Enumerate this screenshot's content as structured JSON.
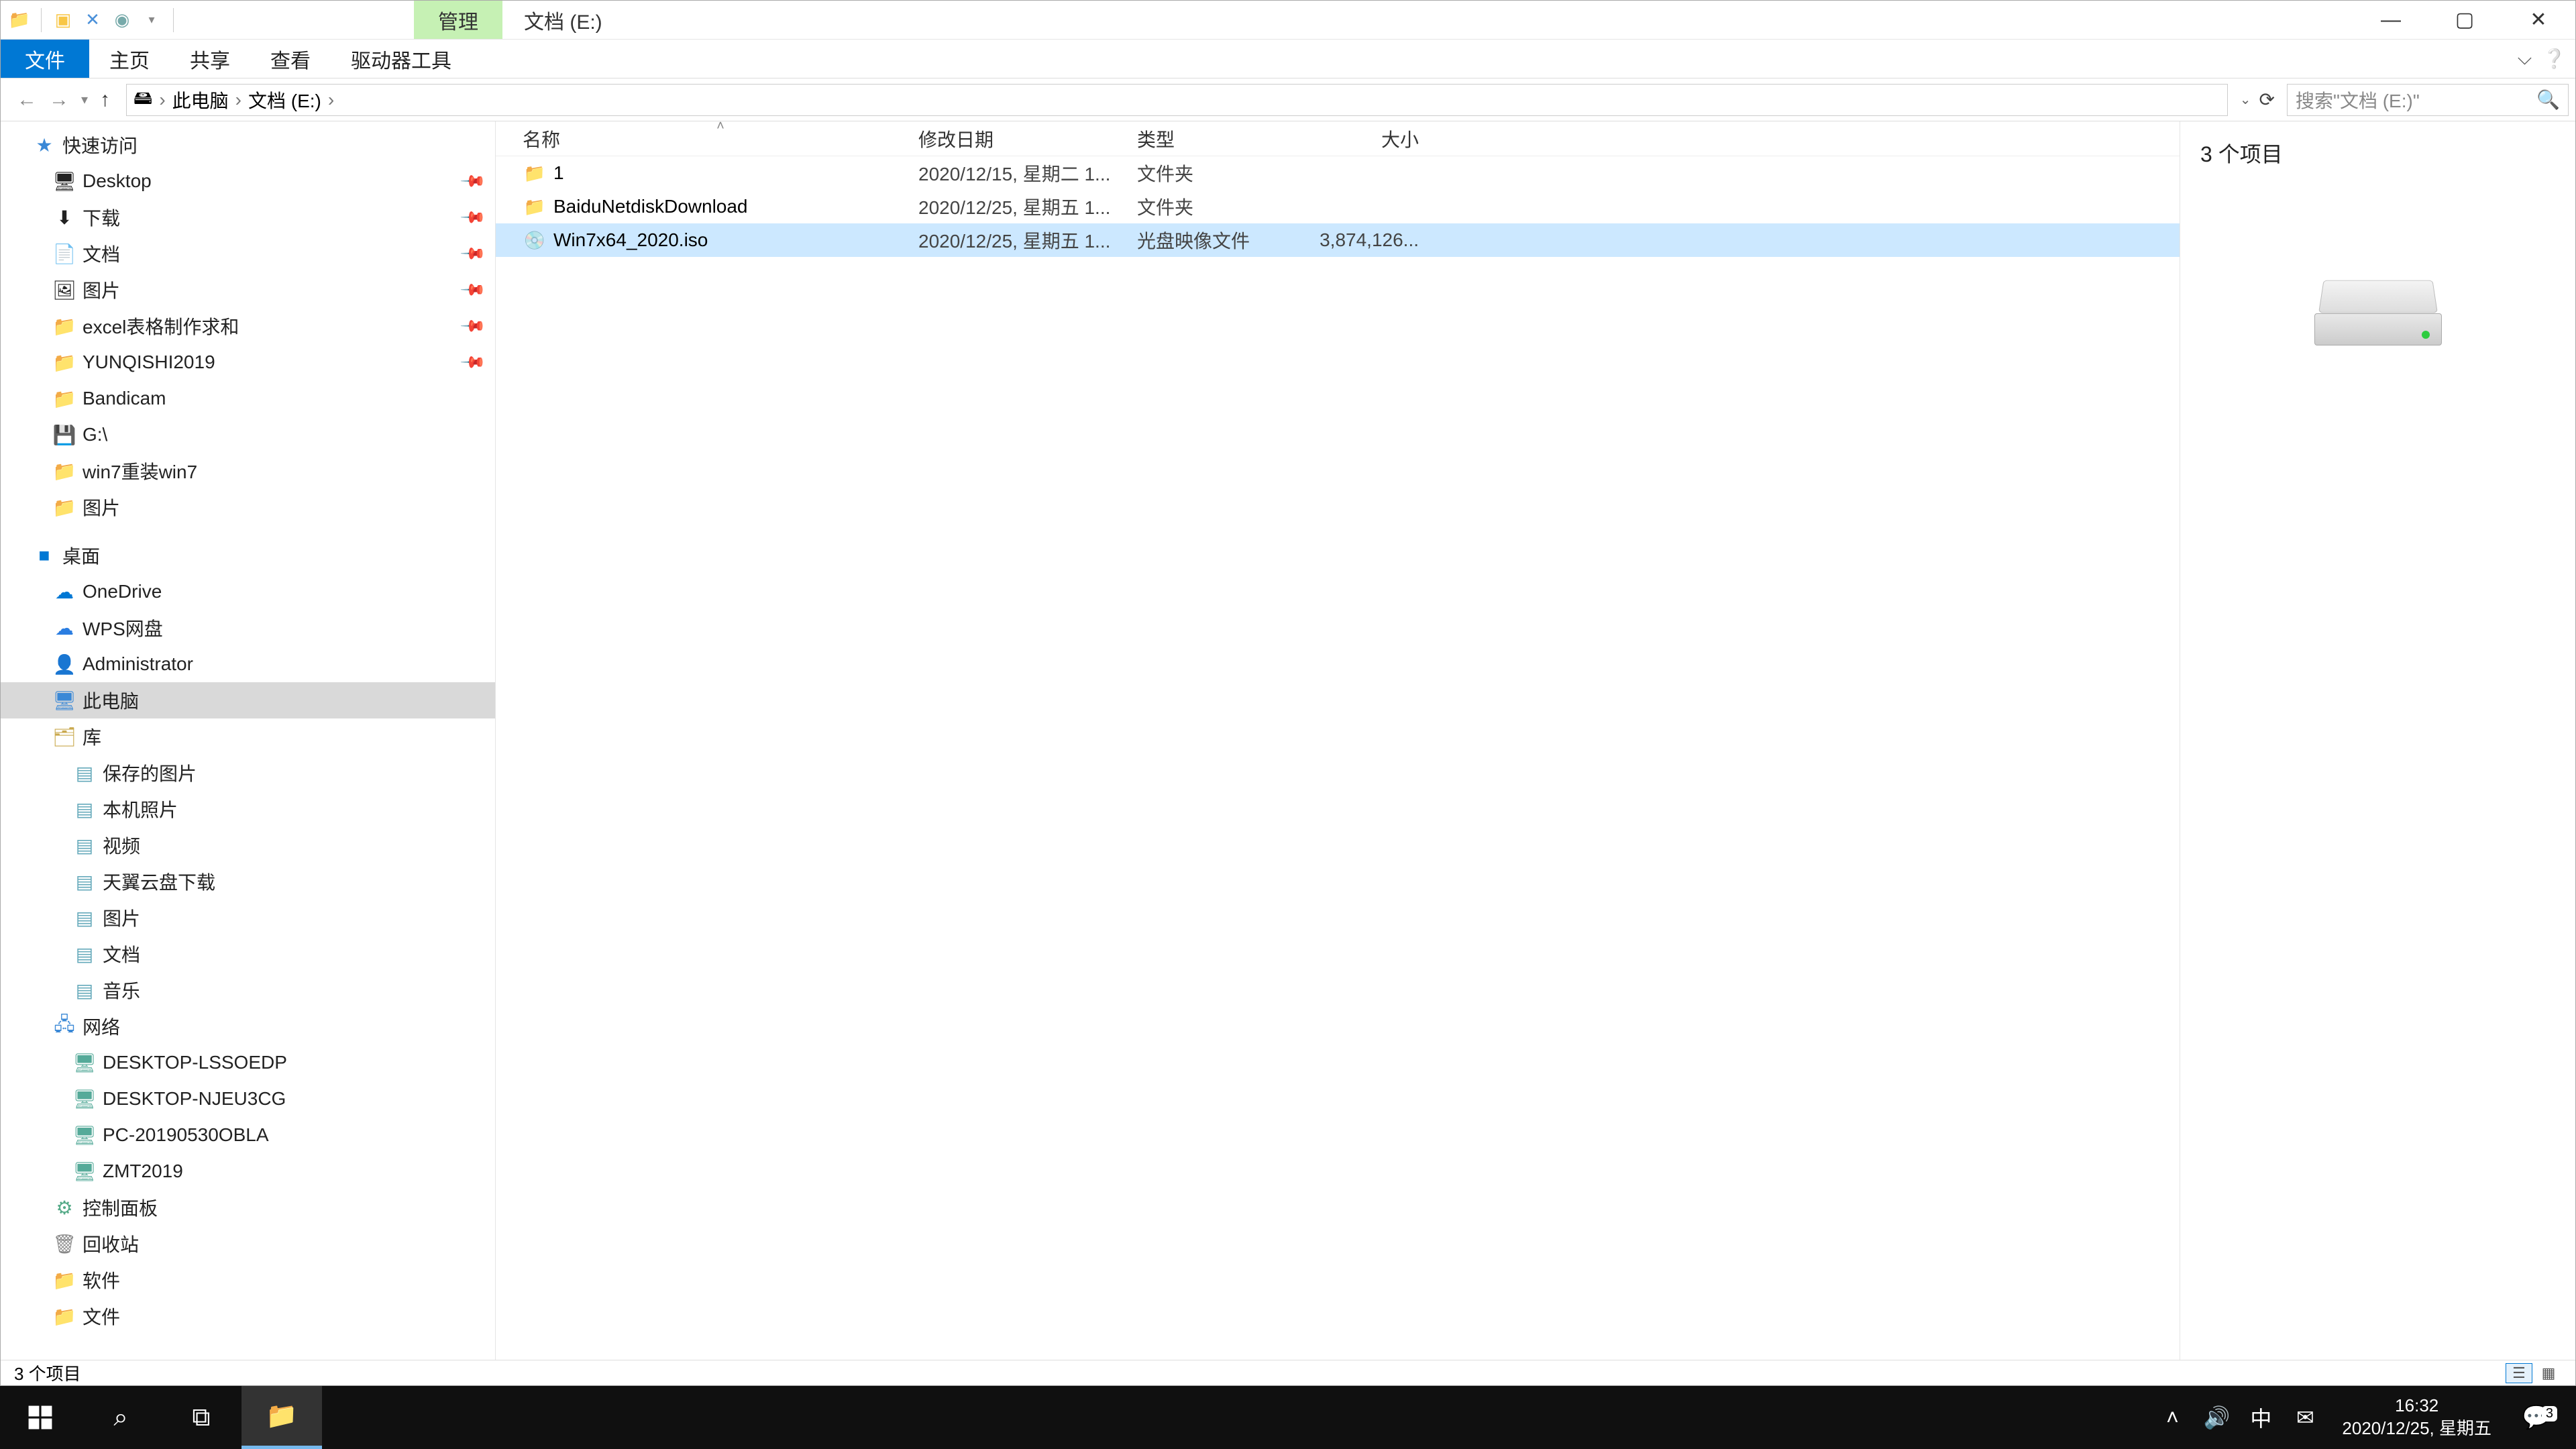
{
  "title": "文档 (E:)",
  "ribbon_context_tab": "管理",
  "ribbon": {
    "file": "文件",
    "home": "主页",
    "share": "共享",
    "view": "查看",
    "drive_tools": "驱动器工具"
  },
  "breadcrumbs": [
    "此电脑",
    "文档 (E:)"
  ],
  "search_placeholder": "搜索\"文档 (E:)\"",
  "columns": {
    "name": "名称",
    "date": "修改日期",
    "type": "类型",
    "size": "大小"
  },
  "files": [
    {
      "icon": "folder",
      "name": "1",
      "date": "2020/12/15, 星期二 1...",
      "type": "文件夹",
      "size": ""
    },
    {
      "icon": "folder",
      "name": "BaiduNetdiskDownload",
      "date": "2020/12/25, 星期五 1...",
      "type": "文件夹",
      "size": ""
    },
    {
      "icon": "disc",
      "name": "Win7x64_2020.iso",
      "date": "2020/12/25, 星期五 1...",
      "type": "光盘映像文件",
      "size": "3,874,126..."
    }
  ],
  "selected_row": 2,
  "nav": {
    "quick_access": "快速访问",
    "qa_items": [
      {
        "label": "Desktop",
        "icon": "🖥",
        "pin": true
      },
      {
        "label": "下载",
        "icon": "⬇",
        "pin": true
      },
      {
        "label": "文档",
        "icon": "📄",
        "pin": true
      },
      {
        "label": "图片",
        "icon": "🖼",
        "pin": true
      },
      {
        "label": "excel表格制作求和",
        "icon": "📁",
        "pin": true
      },
      {
        "label": "YUNQISHI2019",
        "icon": "📁",
        "pin": true
      },
      {
        "label": "Bandicam",
        "icon": "📁",
        "pin": false
      },
      {
        "label": "G:\\",
        "icon": "💾",
        "pin": false
      },
      {
        "label": "win7重装win7",
        "icon": "📁",
        "pin": false
      },
      {
        "label": "图片",
        "icon": "📁",
        "pin": false
      }
    ],
    "desktop": "桌面",
    "onedrive": "OneDrive",
    "wps": "WPS网盘",
    "admin": "Administrator",
    "this_pc": "此电脑",
    "libraries": "库",
    "lib_items": [
      "保存的图片",
      "本机照片",
      "视频",
      "天翼云盘下载",
      "图片",
      "文档",
      "音乐"
    ],
    "network": "网络",
    "net_items": [
      "DESKTOP-LSSOEDP",
      "DESKTOP-NJEU3CG",
      "PC-20190530OBLA",
      "ZMT2019"
    ],
    "control_panel": "控制面板",
    "recycle": "回收站",
    "soft": "软件",
    "docs": "文件"
  },
  "preview_title": "3 个项目",
  "status_text": "3 个项目",
  "taskbar": {
    "time": "16:32",
    "date": "2020/12/25, 星期五",
    "ime": "中",
    "notif_count": "3"
  }
}
